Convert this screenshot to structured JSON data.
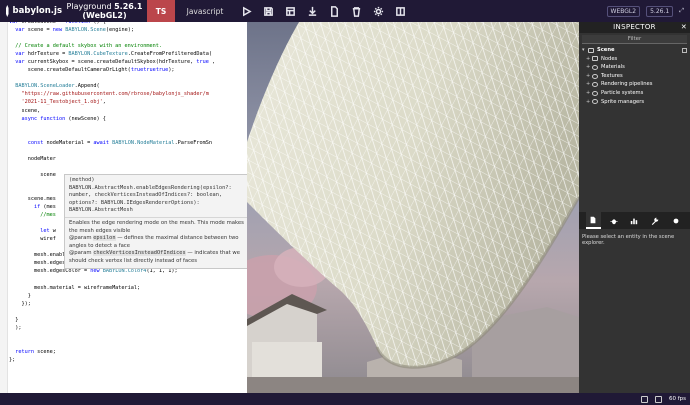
{
  "topbar": {
    "logo": "babylon.js",
    "title": "Playground",
    "version": "5.26.1 (WebGL2)",
    "lang_ts": "TS",
    "lang_js": "Javascript",
    "right": [
      "WEBGL2",
      "5.26.1"
    ]
  },
  "editor": {
    "lines": [
      [
        [
          "kw",
          "var "
        ],
        [
          "",
          "createScene = "
        ],
        [
          "kw",
          "function"
        ],
        [
          "",
          " () {"
        ]
      ],
      [
        [
          "",
          ""
        ],
        [
          "kw",
          "  var "
        ],
        [
          "",
          "scene = "
        ],
        [
          "kw",
          "new "
        ],
        [
          "ty",
          "BABYLON.Scene"
        ],
        [
          "",
          "(engine);"
        ]
      ],
      [
        [
          "",
          ""
        ]
      ],
      [
        [
          "cm",
          "  // Create a default skybox with an environment."
        ]
      ],
      [
        [
          "kw",
          "  var "
        ],
        [
          "",
          "hdrTexture = "
        ],
        [
          "ty",
          "BABYLON.CubeTexture"
        ],
        [
          "",
          ".CreateFromPrefilteredData("
        ]
      ],
      [
        [
          "kw",
          "  var "
        ],
        [
          "",
          "currentSkybox = scene.createDefaultSkybox(hdrTexture, "
        ],
        [
          "kw",
          "true"
        ],
        [
          "",
          " ,"
        ]
      ],
      [
        [
          "",
          "      scene.createDefaultCameraOrLight("
        ],
        [
          "kw",
          "true"
        ],
        [
          ", "
        ],
        [
          "kw",
          "true"
        ],
        [
          ", "
        ],
        [
          "kw",
          "true"
        ],
        [
          "",
          ");"
        ]
      ],
      [
        [
          "",
          ""
        ]
      ],
      [
        [
          "ty",
          "  BABYLON.SceneLoader"
        ],
        [
          "",
          ".Append("
        ]
      ],
      [
        [
          "st",
          "    \"https://raw.githubusercontent.com/rbrose/babylonjs_shader/m"
        ]
      ],
      [
        [
          "st",
          "    '2021-11_Testobject_1.obj'"
        ],
        [
          "",
          ","
        ]
      ],
      [
        [
          "",
          "    scene,"
        ]
      ],
      [
        [
          "kw",
          "    async function "
        ],
        [
          "",
          "(newScene) {"
        ]
      ],
      [
        [
          "",
          ""
        ]
      ],
      [
        [
          "",
          ""
        ]
      ],
      [
        [
          "kw",
          "      const "
        ],
        [
          "",
          "nodeMaterial = "
        ],
        [
          "kw",
          "await "
        ],
        [
          "ty",
          "BABYLON.NodeMaterial"
        ],
        [
          "",
          ".ParseFromSn"
        ]
      ],
      [
        [
          "",
          ""
        ]
      ],
      [
        [
          "",
          "      nodeMater"
        ]
      ],
      [
        [
          "",
          ""
        ]
      ],
      [
        [
          "",
          "          scene"
        ]
      ],
      [
        [
          "",
          ""
        ]
      ],
      [
        [
          "",
          ""
        ]
      ],
      [
        [
          "",
          "      scene.mes"
        ]
      ],
      [
        [
          "kw",
          "        if "
        ],
        [
          "",
          "(mes"
        ]
      ],
      [
        [
          "cm",
          "          //mes"
        ]
      ],
      [
        [
          "",
          ""
        ]
      ],
      [
        [
          "kw",
          "          let "
        ],
        [
          "",
          "w"
        ]
      ],
      [
        [
          "",
          "          wiref"
        ]
      ],
      [
        [
          "",
          ""
        ]
      ],
      [
        [
          "",
          "        mesh.enableEdgesRendering(2);"
        ]
      ],
      [
        [
          "",
          "        mesh.edgesWidth = 3.93;"
        ]
      ],
      [
        [
          "",
          "        mesh.edgesColor = "
        ],
        [
          "kw",
          "new "
        ],
        [
          "ty",
          "BABYLON.Color4"
        ],
        [
          "",
          "(1, 1, 1);"
        ]
      ],
      [
        [
          "",
          ""
        ]
      ],
      [
        [
          "",
          "        mesh.material = wireframeMaterial;"
        ]
      ],
      [
        [
          "",
          "      }"
        ]
      ],
      [
        [
          "",
          "    });"
        ]
      ],
      [
        [
          "",
          ""
        ]
      ],
      [
        [
          "",
          "  }"
        ]
      ],
      [
        [
          "",
          "  );"
        ]
      ],
      [
        [
          "",
          ""
        ]
      ],
      [
        [
          "",
          ""
        ]
      ],
      [
        [
          "kw",
          "  return "
        ],
        [
          "",
          "scene;"
        ]
      ],
      [
        [
          "",
          "};"
        ]
      ]
    ],
    "tooltip": {
      "signature": "(method)\nBABYLON.AbstractMesh.enableEdgesRendering(epsilon?:\nnumber, checkVerticesInsteadOfIndices?: boolean,\noptions?: BABYLON.IEdgesRendererOptions):\nBABYLON.AbstractMesh",
      "doc_intro": "Enables the edge rendering mode on the mesh. This mode makes the mesh edges visible",
      "param1_tag": "@param",
      "param1_name": "epsilon",
      "param1_text": " — defines the maximal distance between two angles to detect a face",
      "param2_tag": "@param",
      "param2_name": "checkVerticesInsteadOfIndices",
      "param2_text": " — indicates that we should check vertex list directly instead of faces"
    }
  },
  "inspector": {
    "title": "INSPECTOR",
    "filter": "Filter",
    "tree": [
      {
        "label": "Scene",
        "level": "root",
        "icon": "scene-icon"
      },
      {
        "label": "Nodes",
        "level": "child",
        "icon": "nodes-icon"
      },
      {
        "label": "Materials",
        "level": "child",
        "icon": "materials-icon"
      },
      {
        "label": "Textures",
        "level": "child",
        "icon": "textures-icon"
      },
      {
        "label": "Rendering pipelines",
        "level": "child",
        "icon": "pipelines-icon"
      },
      {
        "label": "Particle systems",
        "level": "child",
        "icon": "particles-icon"
      },
      {
        "label": "Sprite managers",
        "level": "child",
        "icon": "sprites-icon"
      }
    ],
    "empty_message": "Please select an entity in the scene explorer."
  },
  "bottombar": {
    "fps": "60 fps"
  },
  "colors": {
    "topbar": "#201936",
    "ts_tab": "#bb464b",
    "inspector_bg": "#333333",
    "mesh_fill": "#e5e4d6",
    "wire": "#ffffff"
  }
}
